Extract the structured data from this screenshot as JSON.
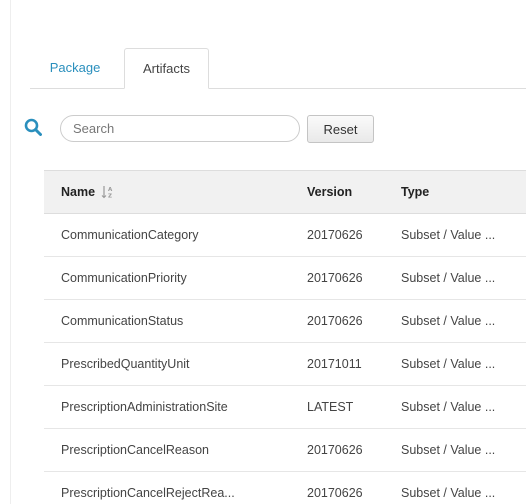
{
  "tabs": {
    "package_label": "Package",
    "artifacts_label": "Artifacts"
  },
  "search": {
    "placeholder": "Search",
    "value": "",
    "icon": "search-icon"
  },
  "reset_label": "Reset",
  "colors": {
    "accent": "#2a8fbd",
    "header_bg": "#f1f1f1",
    "border": "#dddddd"
  },
  "table": {
    "headers": {
      "name": "Name",
      "version": "Version",
      "type": "Type"
    },
    "sort_icon": "sort-alpha-asc-icon",
    "rows": [
      {
        "name": "CommunicationCategory",
        "version": "20170626",
        "type": "Subset / Value ..."
      },
      {
        "name": "CommunicationPriority",
        "version": "20170626",
        "type": "Subset / Value ..."
      },
      {
        "name": "CommunicationStatus",
        "version": "20170626",
        "type": "Subset / Value ..."
      },
      {
        "name": "PrescribedQuantityUnit",
        "version": "20171011",
        "type": "Subset / Value ..."
      },
      {
        "name": "PrescriptionAdministrationSite",
        "version": "LATEST",
        "type": "Subset / Value ..."
      },
      {
        "name": "PrescriptionCancelReason",
        "version": "20170626",
        "type": "Subset / Value ..."
      },
      {
        "name": "PrescriptionCancelRejectRea...",
        "version": "20170626",
        "type": "Subset / Value ..."
      }
    ]
  }
}
